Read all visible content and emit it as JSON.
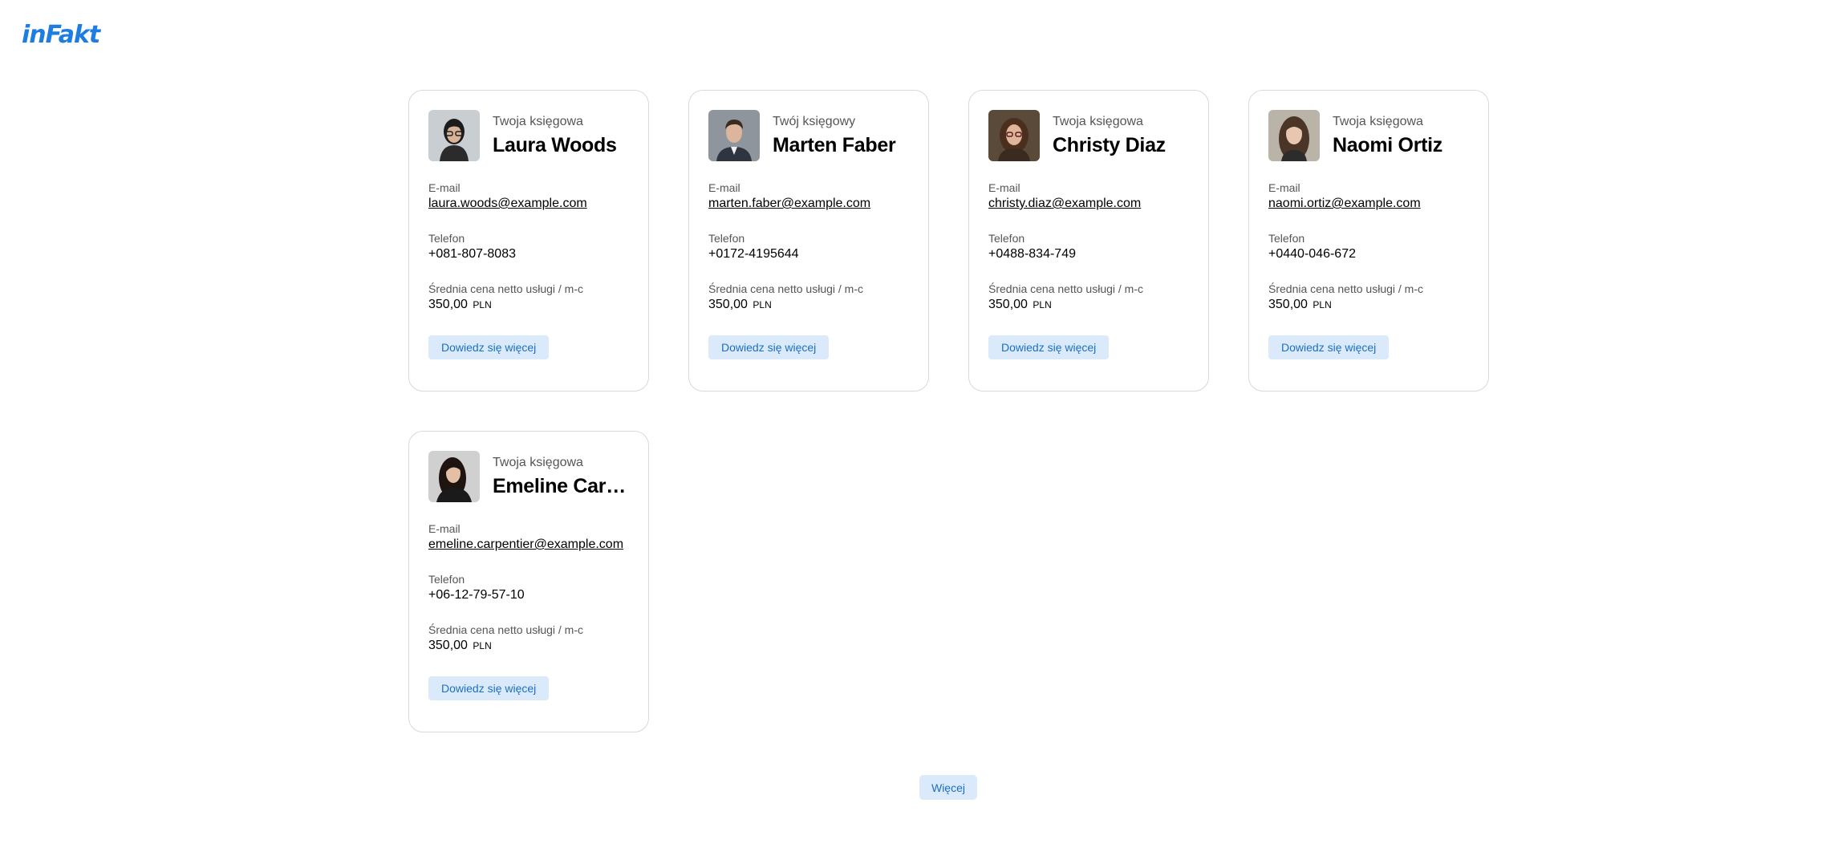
{
  "app": {
    "logo_text": "inFakt",
    "brand_color": "#1e7de0",
    "button_bg": "#dbeafa"
  },
  "cards": [
    {
      "role": "Twoja księgowa",
      "name": "Laura Woods",
      "email_label": "E-mail",
      "email": "laura.woods@example.com",
      "phone_label": "Telefon",
      "phone": "+081-807-8083",
      "price_label": "Średnia cena netto usługi / m-c",
      "price": "350,00",
      "currency": "PLN",
      "button": "Dowiedz się więcej"
    },
    {
      "role": "Twój księgowy",
      "name": "Marten Faber",
      "email_label": "E-mail",
      "email": "marten.faber@example.com",
      "phone_label": "Telefon",
      "phone": "+0172-4195644",
      "price_label": "Średnia cena netto usługi / m-c",
      "price": "350,00",
      "currency": "PLN",
      "button": "Dowiedz się więcej"
    },
    {
      "role": "Twoja księgowa",
      "name": "Christy Diaz",
      "email_label": "E-mail",
      "email": "christy.diaz@example.com",
      "phone_label": "Telefon",
      "phone": "+0488-834-749",
      "price_label": "Średnia cena netto usługi / m-c",
      "price": "350,00",
      "currency": "PLN",
      "button": "Dowiedz się więcej"
    },
    {
      "role": "Twoja księgowa",
      "name": "Naomi Ortiz",
      "email_label": "E-mail",
      "email": "naomi.ortiz@example.com",
      "phone_label": "Telefon",
      "phone": "+0440-046-672",
      "price_label": "Średnia cena netto usługi / m-c",
      "price": "350,00",
      "currency": "PLN",
      "button": "Dowiedz się więcej"
    },
    {
      "role": "Twoja księgowa",
      "name": "Emeline Carpentier",
      "email_label": "E-mail",
      "email": "emeline.carpentier@example.com",
      "phone_label": "Telefon",
      "phone": "+06-12-79-57-10",
      "price_label": "Średnia cena netto usługi / m-c",
      "price": "350,00",
      "currency": "PLN",
      "button": "Dowiedz się więcej"
    }
  ],
  "more_button": "Więcej"
}
